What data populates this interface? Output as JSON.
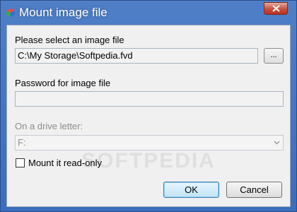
{
  "window": {
    "title": "Mount image file",
    "icon": "cube-app-icon",
    "close_icon": "close-icon"
  },
  "image_file": {
    "label": "Please select an image file",
    "value": "C:\\My Storage\\Softpedia.fvd",
    "browse_label": "..."
  },
  "password": {
    "label": "Password for image file",
    "value": ""
  },
  "drive": {
    "label": "On a drive letter:",
    "selected": "F:"
  },
  "readonly": {
    "label": "Mount it read-only",
    "checked": false
  },
  "watermark": "SOFTPEDIA",
  "buttons": {
    "ok": "OK",
    "cancel": "Cancel"
  },
  "colors": {
    "titlebar": "#3b6dbd",
    "client_bg": "#f0f0f0",
    "close_button": "#c8503e",
    "default_button_border": "#3c7fb1"
  }
}
